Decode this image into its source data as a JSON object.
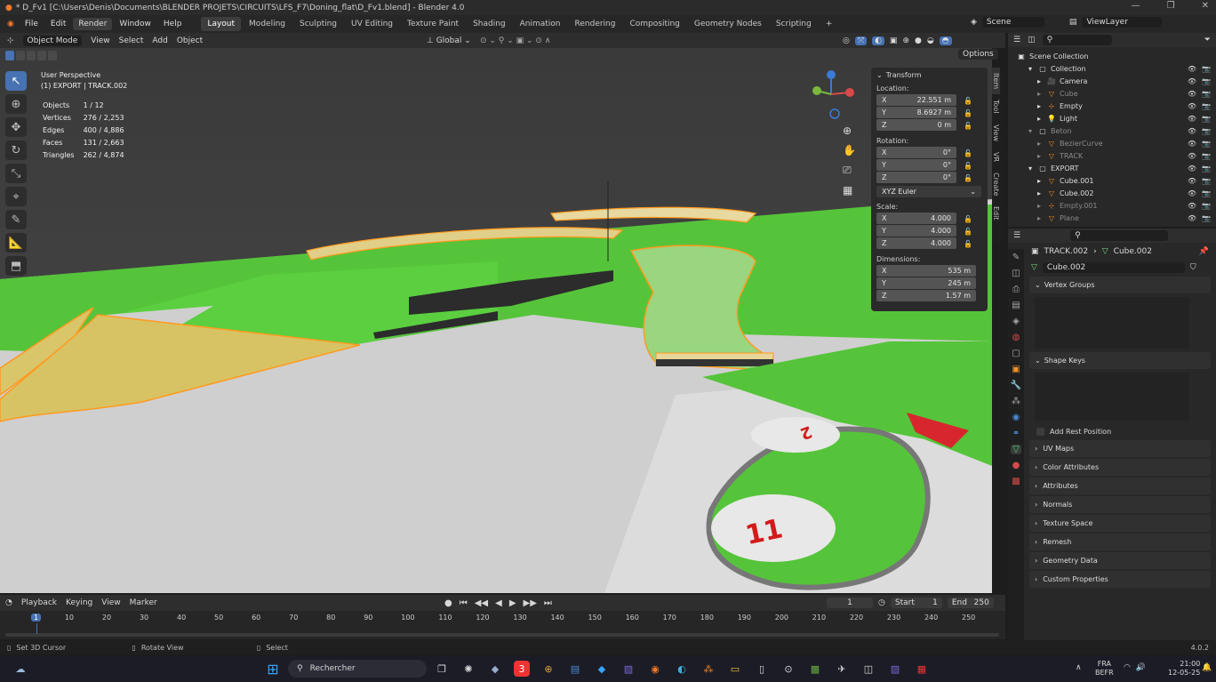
{
  "window": {
    "title": "* D_Fv1 [C:\\Users\\Denis\\Documents\\BLENDER PROJETS\\CIRCUITS\\LFS_F7\\Doning_flat\\D_Fv1.blend] - Blender 4.0"
  },
  "menu": {
    "items": [
      "File",
      "Edit",
      "Render",
      "Window",
      "Help"
    ]
  },
  "workspaces": [
    "Layout",
    "Modeling",
    "Sculpting",
    "UV Editing",
    "Texture Paint",
    "Shading",
    "Animation",
    "Rendering",
    "Compositing",
    "Geometry Nodes",
    "Scripting"
  ],
  "scene": {
    "label": "Scene",
    "viewlayer": "ViewLayer"
  },
  "viewport_header": {
    "mode": "Object Mode",
    "menus": [
      "View",
      "Select",
      "Add",
      "Object"
    ],
    "orientation": "Global",
    "options": "Options"
  },
  "overlay": {
    "view_name": "User Perspective",
    "active": "(1) EXPORT | TRACK.002"
  },
  "stats": [
    {
      "k": "Objects",
      "v": "1 / 12"
    },
    {
      "k": "Vertices",
      "v": "276 / 2,253"
    },
    {
      "k": "Edges",
      "v": "400 / 4,886"
    },
    {
      "k": "Faces",
      "v": "131 / 2,663"
    },
    {
      "k": "Triangles",
      "v": "262 / 4,874"
    }
  ],
  "transform": {
    "title": "Transform",
    "location_label": "Location:",
    "location": [
      {
        "a": "X",
        "v": "22.551 m"
      },
      {
        "a": "Y",
        "v": "8.6927 m"
      },
      {
        "a": "Z",
        "v": "0 m"
      }
    ],
    "rotation_label": "Rotation:",
    "rotation": [
      {
        "a": "X",
        "v": "0°"
      },
      {
        "a": "Y",
        "v": "0°"
      },
      {
        "a": "Z",
        "v": "0°"
      }
    ],
    "rotation_mode": "XYZ Euler",
    "scale_label": "Scale:",
    "scale": [
      {
        "a": "X",
        "v": "4.000"
      },
      {
        "a": "Y",
        "v": "4.000"
      },
      {
        "a": "Z",
        "v": "4.000"
      }
    ],
    "dimensions_label": "Dimensions:",
    "dimensions": [
      {
        "a": "X",
        "v": "535 m"
      },
      {
        "a": "Y",
        "v": "245 m"
      },
      {
        "a": "Z",
        "v": "1.57 m"
      }
    ]
  },
  "side_tabs": [
    "Item",
    "Tool",
    "View",
    "VR",
    "Create",
    "Edit"
  ],
  "outliner": {
    "root": "Scene Collection",
    "items": [
      {
        "name": "Collection",
        "indent": 1,
        "dim": false
      },
      {
        "name": "Camera",
        "indent": 2,
        "dim": false
      },
      {
        "name": "Cube",
        "indent": 2,
        "dim": true
      },
      {
        "name": "Empty",
        "indent": 2,
        "dim": false
      },
      {
        "name": "Light",
        "indent": 2,
        "dim": false
      },
      {
        "name": "Beton",
        "indent": 1,
        "dim": true
      },
      {
        "name": "BezierCurve",
        "indent": 2,
        "dim": true
      },
      {
        "name": "TRACK",
        "indent": 2,
        "dim": true
      },
      {
        "name": "EXPORT",
        "indent": 1,
        "dim": false
      },
      {
        "name": "Cube.001",
        "indent": 2,
        "dim": false
      },
      {
        "name": "Cube.002",
        "indent": 2,
        "dim": false
      },
      {
        "name": "Empty.001",
        "indent": 2,
        "dim": true
      },
      {
        "name": "Plane",
        "indent": 2,
        "dim": true
      }
    ]
  },
  "properties": {
    "breadcrumb_object": "TRACK.002",
    "breadcrumb_data": "Cube.002",
    "data_name": "Cube.002",
    "vertex_groups": "Vertex Groups",
    "shape_keys": "Shape Keys",
    "add_rest_position": "Add Rest Position",
    "panels": [
      "UV Maps",
      "Color Attributes",
      "Attributes",
      "Normals",
      "Texture Space",
      "Remesh",
      "Geometry Data",
      "Custom Properties"
    ]
  },
  "timeline": {
    "menus": [
      "Playback",
      "Keying",
      "View",
      "Marker"
    ],
    "current_frame": "1",
    "start_label": "Start",
    "start": "1",
    "end_label": "End",
    "end": "250",
    "ticks": [
      "1",
      "10",
      "20",
      "30",
      "40",
      "50",
      "60",
      "70",
      "80",
      "90",
      "100",
      "110",
      "120",
      "130",
      "140",
      "150",
      "160",
      "170",
      "180",
      "190",
      "200",
      "210",
      "220",
      "230",
      "240",
      "250"
    ]
  },
  "status": {
    "left": "Set 3D Cursor",
    "mid": "Rotate View",
    "right": "Select",
    "version": "4.0.2"
  },
  "taskbar": {
    "search": "Rechercher",
    "lang1": "FRA",
    "lang2": "BEFR",
    "time": "21:00",
    "date": "12-05-25"
  }
}
